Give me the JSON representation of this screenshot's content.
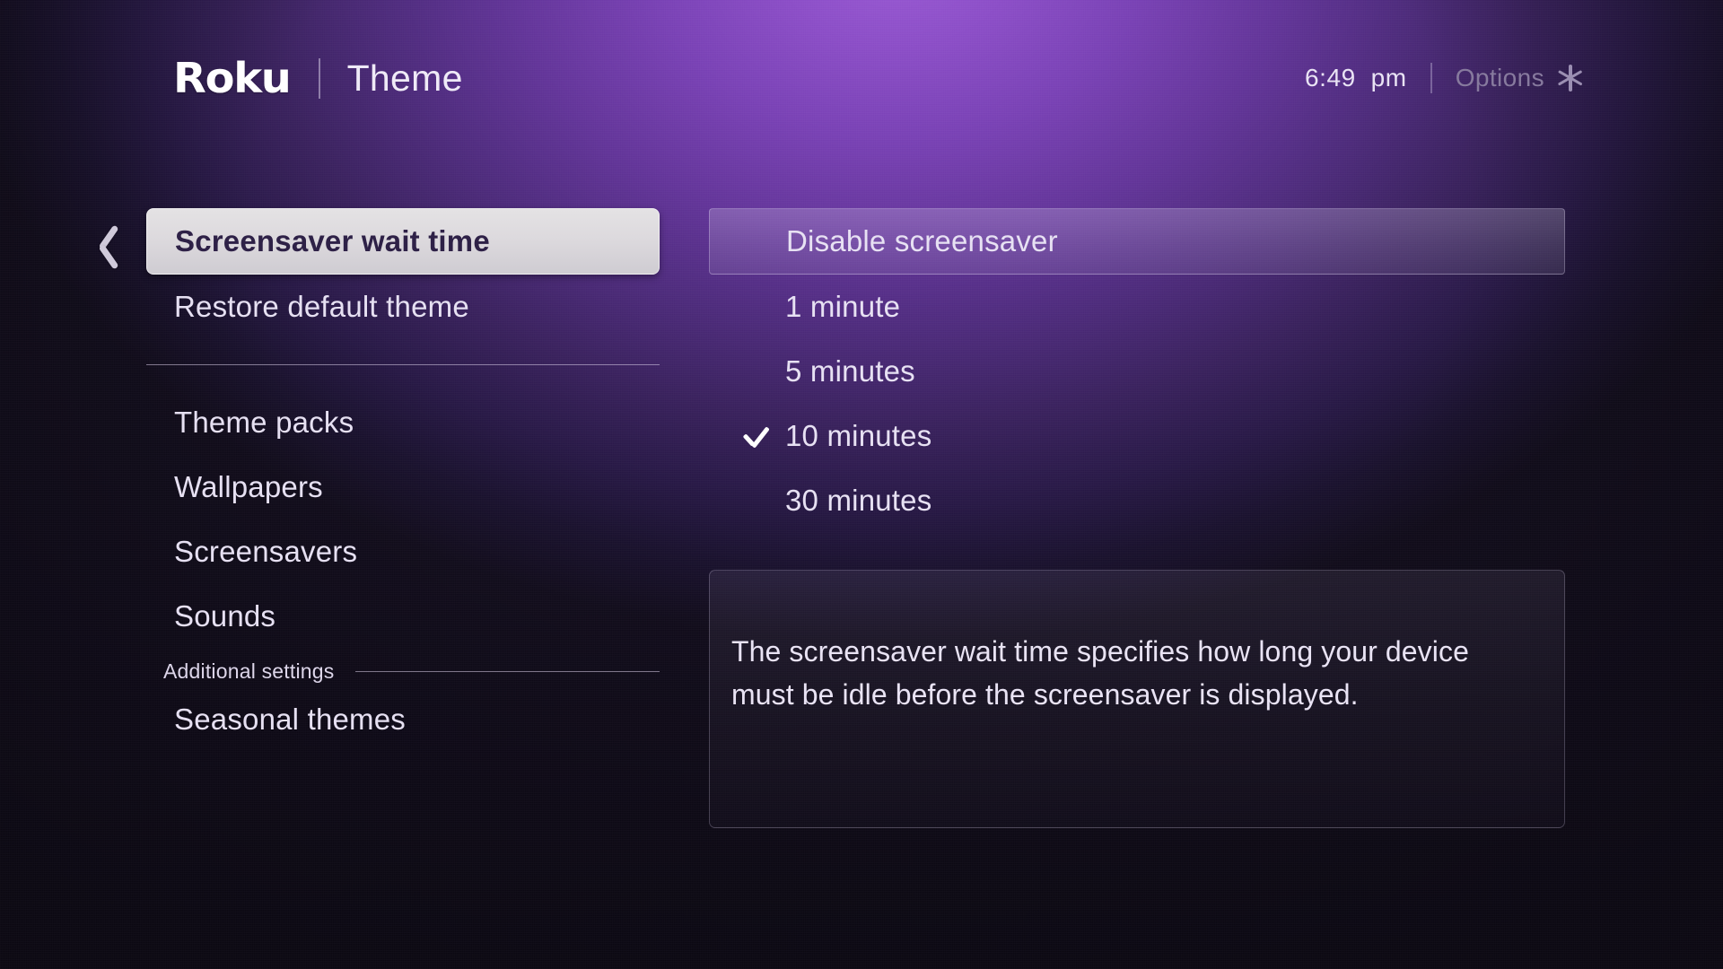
{
  "header": {
    "brand": "Roku",
    "title": "Theme",
    "clock": "6:49  pm",
    "options_label": "Options",
    "options_icon": "asterisk-icon",
    "separator": "|"
  },
  "back_icon": "chevron-left-icon",
  "sidebar": {
    "items": [
      {
        "label": "Screensaver wait time",
        "selected": true
      },
      {
        "label": "Restore default theme",
        "selected": false
      },
      {
        "label": "Theme packs",
        "selected": false
      },
      {
        "label": "Wallpapers",
        "selected": false
      },
      {
        "label": "Screensavers",
        "selected": false
      },
      {
        "label": "Sounds",
        "selected": false
      }
    ],
    "section_heading": "Additional settings",
    "section_items": [
      {
        "label": "Seasonal themes",
        "selected": false
      }
    ]
  },
  "options_list": {
    "items": [
      {
        "label": "Disable screensaver",
        "highlighted": true,
        "checked": false
      },
      {
        "label": "1 minute",
        "highlighted": false,
        "checked": false
      },
      {
        "label": "5 minutes",
        "highlighted": false,
        "checked": false
      },
      {
        "label": "10 minutes",
        "highlighted": false,
        "checked": true
      },
      {
        "label": "30 minutes",
        "highlighted": false,
        "checked": false
      }
    ],
    "checked_value": "10 minutes"
  },
  "description": {
    "text": "The screensaver wait time specifies how long your device must be idle before the screensaver is displayed."
  },
  "colors": {
    "accent_purple": "#7a3fb5",
    "glow_purple": "#9a5ad4",
    "background_dark": "#120d1c",
    "selected_bg": "#dcd9dd",
    "selected_text": "#2e2147",
    "text_primary": "#e7e1f3",
    "text_dim": "#877a9e"
  }
}
